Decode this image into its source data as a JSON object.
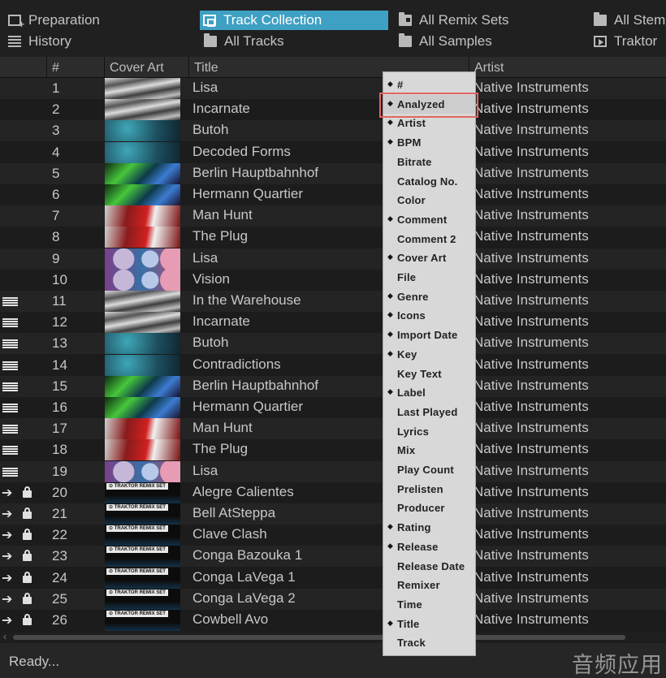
{
  "favorites": [
    {
      "label": "Preparation",
      "icon": "preparation-list-icon",
      "selected": false
    },
    {
      "label": "Track Collection",
      "icon": "track-collection-icon",
      "selected": true
    },
    {
      "label": "All Remix Sets",
      "icon": "folder-icon",
      "selected": false
    },
    {
      "label": "All Stem",
      "icon": "folder-icon",
      "selected": false
    },
    {
      "label": "History",
      "icon": "history-list-icon",
      "selected": false
    },
    {
      "label": "All Tracks",
      "icon": "folder-icon",
      "selected": false
    },
    {
      "label": "All Samples",
      "icon": "folder-icon",
      "selected": false
    },
    {
      "label": "Traktor",
      "icon": "playlist-icon",
      "selected": false
    }
  ],
  "columns": {
    "num": "#",
    "cover_art": "Cover Art",
    "title": "Title",
    "artist": "Artist"
  },
  "tracks": [
    {
      "num": "1",
      "title": "Lisa",
      "artist": "Native Instruments",
      "art": "noise",
      "flag": "none"
    },
    {
      "num": "2",
      "title": "Incarnate",
      "artist": "Native Instruments",
      "art": "noise",
      "flag": "none"
    },
    {
      "num": "3",
      "title": "Butoh",
      "artist": "Native Instruments",
      "art": "teal",
      "flag": "none"
    },
    {
      "num": "4",
      "title": "Decoded Forms",
      "artist": "Native Instruments",
      "art": "teal",
      "flag": "none"
    },
    {
      "num": "5",
      "title": "Berlin Hauptbahnhof",
      "artist": "Native Instruments",
      "art": "green",
      "flag": "none"
    },
    {
      "num": "6",
      "title": "Hermann Quartier",
      "artist": "Native Instruments",
      "art": "green",
      "flag": "none"
    },
    {
      "num": "7",
      "title": "Man Hunt",
      "artist": "Native Instruments",
      "art": "red",
      "flag": "none"
    },
    {
      "num": "8",
      "title": "The Plug",
      "artist": "Native Instruments",
      "art": "red",
      "flag": "none"
    },
    {
      "num": "9",
      "title": "Lisa",
      "artist": "Native Instruments",
      "art": "pattern",
      "flag": "none"
    },
    {
      "num": "10",
      "title": "Vision",
      "artist": "Native Instruments",
      "art": "pattern",
      "flag": "none"
    },
    {
      "num": "11",
      "title": "In the Warehouse",
      "artist": "Native Instruments",
      "art": "noise",
      "flag": "list"
    },
    {
      "num": "12",
      "title": "Incarnate",
      "artist": "Native Instruments",
      "art": "noise",
      "flag": "list"
    },
    {
      "num": "13",
      "title": "Butoh",
      "artist": "Native Instruments",
      "art": "teal",
      "flag": "list"
    },
    {
      "num": "14",
      "title": "Contradictions",
      "artist": "Native Instruments",
      "art": "teal",
      "flag": "list"
    },
    {
      "num": "15",
      "title": "Berlin Hauptbahnhof",
      "artist": "Native Instruments",
      "art": "green",
      "flag": "list"
    },
    {
      "num": "16",
      "title": "Hermann Quartier",
      "artist": "Native Instruments",
      "art": "green",
      "flag": "list"
    },
    {
      "num": "17",
      "title": "Man Hunt",
      "artist": "Native Instruments",
      "art": "red",
      "flag": "list"
    },
    {
      "num": "18",
      "title": "The Plug",
      "artist": "Native Instruments",
      "art": "red",
      "flag": "list"
    },
    {
      "num": "19",
      "title": "Lisa",
      "artist": "Native Instruments",
      "art": "pattern",
      "flag": "list"
    },
    {
      "num": "20",
      "title": "Alegre Calientes",
      "artist": "Native Instruments",
      "art": "remix",
      "flag": "lock"
    },
    {
      "num": "21",
      "title": "Bell AtSteppa",
      "artist": "Native Instruments",
      "art": "remix",
      "flag": "lock"
    },
    {
      "num": "22",
      "title": "Clave Clash",
      "artist": "Native Instruments",
      "art": "remix",
      "flag": "lock"
    },
    {
      "num": "23",
      "title": "Conga Bazouka 1",
      "artist": "Native Instruments",
      "art": "remix",
      "flag": "lock"
    },
    {
      "num": "24",
      "title": "Conga LaVega 1",
      "artist": "Native Instruments",
      "art": "remix",
      "flag": "lock"
    },
    {
      "num": "25",
      "title": "Conga LaVega 2",
      "artist": "Native Instruments",
      "art": "remix",
      "flag": "lock"
    },
    {
      "num": "26",
      "title": "Cowbell Avo",
      "artist": "Native Instruments",
      "art": "remix",
      "flag": "lock"
    }
  ],
  "remix_badge_text": "⊙ TRAKTOR REMIX SET",
  "context_menu": {
    "items": [
      {
        "label": "#",
        "checked": true
      },
      {
        "label": "Analyzed",
        "checked": true,
        "highlighted": true
      },
      {
        "label": "Artist",
        "checked": true
      },
      {
        "label": "BPM",
        "checked": true
      },
      {
        "label": "Bitrate",
        "checked": false
      },
      {
        "label": "Catalog No.",
        "checked": false
      },
      {
        "label": "Color",
        "checked": false
      },
      {
        "label": "Comment",
        "checked": true
      },
      {
        "label": "Comment 2",
        "checked": false
      },
      {
        "label": "Cover Art",
        "checked": true
      },
      {
        "label": "File",
        "checked": false
      },
      {
        "label": "Genre",
        "checked": true
      },
      {
        "label": "Icons",
        "checked": true
      },
      {
        "label": "Import Date",
        "checked": true
      },
      {
        "label": "Key",
        "checked": true
      },
      {
        "label": "Key Text",
        "checked": false
      },
      {
        "label": "Label",
        "checked": true
      },
      {
        "label": "Last Played",
        "checked": false
      },
      {
        "label": "Lyrics",
        "checked": false
      },
      {
        "label": "Mix",
        "checked": false
      },
      {
        "label": "Play Count",
        "checked": false
      },
      {
        "label": "Prelisten",
        "checked": false
      },
      {
        "label": "Producer",
        "checked": false
      },
      {
        "label": "Rating",
        "checked": true
      },
      {
        "label": "Release",
        "checked": true
      },
      {
        "label": "Release Date",
        "checked": false
      },
      {
        "label": "Remixer",
        "checked": false
      },
      {
        "label": "Time",
        "checked": false
      },
      {
        "label": "Title",
        "checked": true
      },
      {
        "label": "Track",
        "checked": false
      }
    ]
  },
  "status": {
    "text": "Ready..."
  },
  "watermark": "音频应用",
  "colors": {
    "selection": "#3ea0c3",
    "highlight_border": "#e2665f",
    "menu_bg": "#d8d8d8"
  }
}
